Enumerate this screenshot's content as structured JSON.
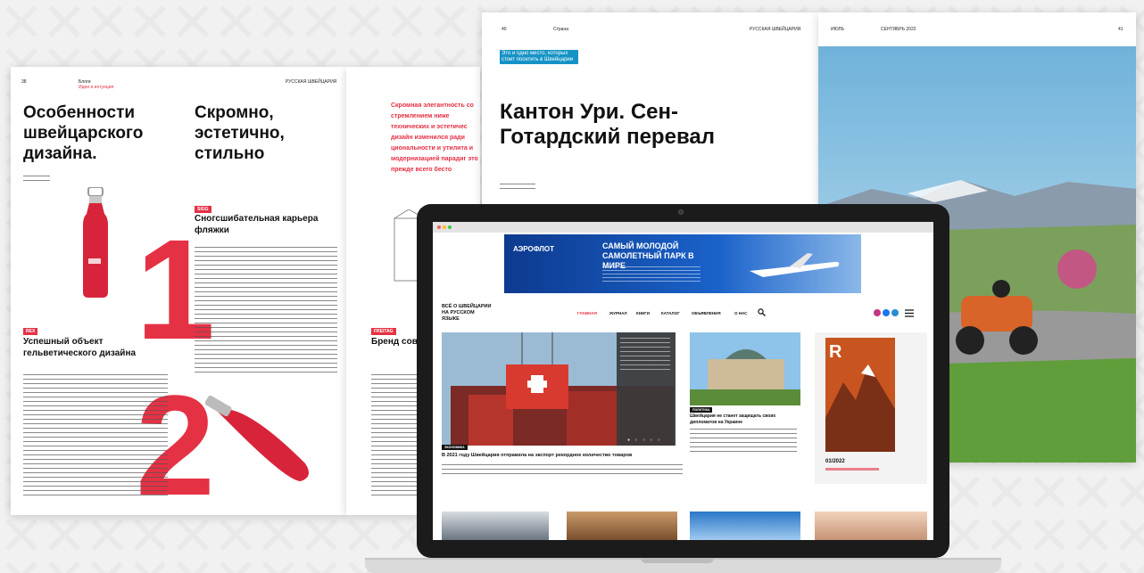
{
  "left_spread": {
    "page_no": "38",
    "section": "Блоги",
    "section_sub": "Идеи и интуиция",
    "header_right": "РУССКАЯ ШВЕЙЦАРИЯ",
    "title": "Особенности швейцарского дизайна.",
    "col_title": "Скромно, эстетично, стильно",
    "tag1": "SIGG",
    "sub1": "Сногсшибательная карьера фляжки",
    "tag2": "REX",
    "sub2": "Успешный объект гельветического дизайна",
    "big1": "1",
    "big2": "2"
  },
  "mid_spread": {
    "quote": "Скромная элегантность со стремлением ниже технических и эстетичес дизайн изменился ради циональности и утилита и модернизацией парадиг это прежде всего бесто",
    "tag": "FREITAG",
    "sub": "Бренд сов Швейцар"
  },
  "right_spread": {
    "page_no": "40",
    "section": "Страна",
    "header_right": "РУССКАЯ ШВЕЙЦАРИЯ",
    "kicker": "Это и одно место, которых стоит посетить в Швейцарии",
    "title": "Кантон Ури. Сен-Готардский перевал"
  },
  "photo_page": {
    "section": "ИЮЛЬ",
    "date": "СЕНТЯБРЬ 2022",
    "page_no": "41"
  },
  "site": {
    "banner_logo": "АЭРОФЛОТ",
    "banner_headline": "САМЫЙ МОЛОДОЙ САМОЛЕТНЫЙ ПАРК В МИРЕ",
    "logo": "ВСЁ О ШВЕЙЦАРИИ НА РУССКОМ ЯЗЫКЕ",
    "nav": [
      "ГЛАВНАЯ",
      "ЖУРНАЛ",
      "КНИГИ",
      "КАТАЛОГ",
      "ОБЪЯВЛЕНИЯ",
      "О НАС"
    ],
    "hero_caption": "В 2021 году Швейцария отправила на экспорт рекордное количество товаров",
    "hero_tag": "ЭКОНОМИКА",
    "side_title": "Швейцария не станет защищать своих дипломатов на Украине",
    "side_tag": "ПОЛИТИКА",
    "mag_issue": "01/2022",
    "mag_cover_letter": "R"
  },
  "colors": {
    "brand_red": "#e53144",
    "aeroflot_blue": "#0d3a8f"
  }
}
